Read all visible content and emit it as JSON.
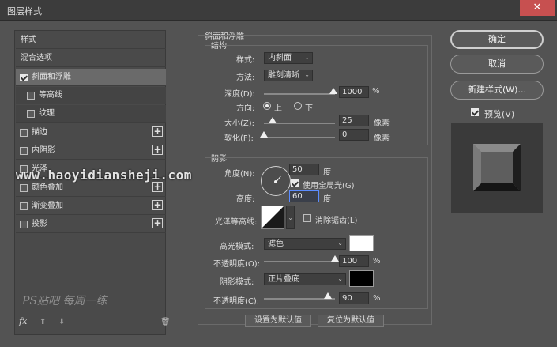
{
  "window": {
    "title": "图层样式",
    "close_glyph": "✕"
  },
  "left_panel": {
    "header": "样式",
    "blend": "混合选项",
    "items": [
      {
        "label": "斜面和浮雕",
        "checked": true,
        "selected": true,
        "plus": false
      },
      {
        "label": "等高线",
        "checked": false,
        "sub": true,
        "plus": false
      },
      {
        "label": "纹理",
        "checked": false,
        "sub": true,
        "plus": false
      },
      {
        "label": "描边",
        "checked": false,
        "plus": true
      },
      {
        "label": "内阴影",
        "checked": false,
        "plus": true
      },
      {
        "label": "光泽",
        "checked": false,
        "plus": false
      },
      {
        "label": "颜色叠加",
        "checked": false,
        "plus": true
      },
      {
        "label": "渐变叠加",
        "checked": false,
        "plus": true
      },
      {
        "label": "投影",
        "checked": false,
        "plus": true
      }
    ],
    "plus_glyph": "+",
    "footer": {
      "fx": "fx",
      "up": "⬆",
      "down": "⬇",
      "trash": "🗑"
    }
  },
  "bevel": {
    "section_title": "斜面和浮雕",
    "structure_title": "结构",
    "style_label": "样式:",
    "style_value": "内斜面",
    "method_label": "方法:",
    "method_value": "雕刻清晰",
    "depth_label": "深度(D):",
    "depth_value": "1000",
    "depth_unit": "%",
    "depth_fraction": 0.98,
    "direction_label": "方向:",
    "dir_up": "上",
    "dir_down": "下",
    "size_label": "大小(Z):",
    "size_value": "25",
    "size_unit": "像素",
    "size_fraction": 0.12,
    "soften_label": "软化(F):",
    "soften_value": "0",
    "soften_unit": "像素",
    "soften_fraction": 0.0,
    "shading_title": "阴影",
    "angle_label": "角度(N):",
    "angle_value": "50",
    "angle_unit": "度",
    "global_light_label": "使用全局光(G)",
    "altitude_label": "高度:",
    "altitude_value": "60",
    "altitude_unit": "度",
    "gloss_label": "光泽等高线:",
    "antialias_label": "消除锯齿(L)",
    "highlight_mode_label": "高光模式:",
    "highlight_mode_value": "滤色",
    "highlight_color": "#ffffff",
    "highlight_opacity_label": "不透明度(O):",
    "highlight_opacity_value": "100",
    "highlight_opacity_unit": "%",
    "highlight_opacity_fraction": 1.0,
    "shadow_mode_label": "阴影模式:",
    "shadow_mode_value": "正片叠底",
    "shadow_color": "#000000",
    "shadow_opacity_label": "不透明度(C):",
    "shadow_opacity_value": "90",
    "shadow_opacity_unit": "%",
    "shadow_opacity_fraction": 0.9,
    "make_default": "设置为默认值",
    "reset_default": "复位为默认值"
  },
  "right": {
    "ok": "确定",
    "cancel": "取消",
    "new_style": "新建样式(W)...",
    "preview_label": "预览(V)"
  },
  "watermark": "www.haoyidiansheji.com",
  "signature": "PS贴吧  每周一练"
}
